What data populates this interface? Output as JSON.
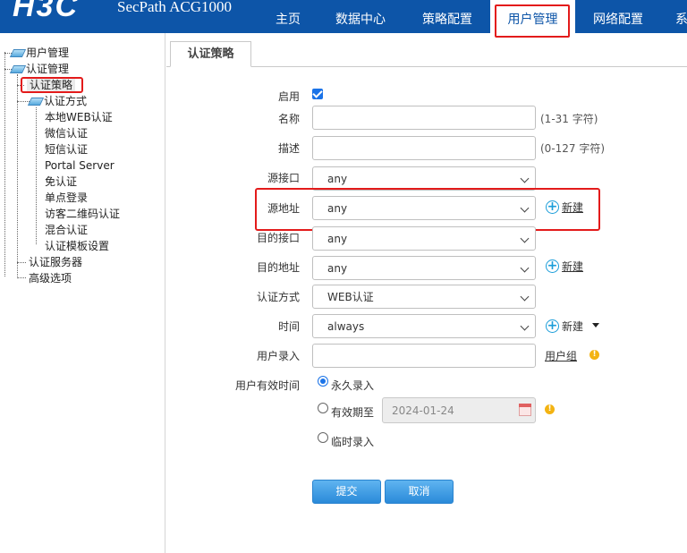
{
  "header": {
    "logo": "H3C",
    "product": "SecPath ACG1000",
    "nav": [
      "主页",
      "数据中心",
      "策略配置",
      "用户管理",
      "网络配置",
      "系"
    ],
    "active_nav": "用户管理",
    "colors": {
      "header_bg": "#0d55a8",
      "highlight": "#e31b1b"
    }
  },
  "sidebar": {
    "items": [
      "用户管理",
      "认证管理",
      "认证策略",
      "认证方式",
      "本地WEB认证",
      "微信认证",
      "短信认证",
      "Portal Server",
      "免认证",
      "单点登录",
      "访客二维码认证",
      "混合认证",
      "认证模板设置",
      "认证服务器",
      "高级选项"
    ],
    "selected": "认证策略"
  },
  "tab": {
    "label": "认证策略"
  },
  "form": {
    "enable_label": "启用",
    "enable_checked": true,
    "name_label": "名称",
    "name_hint": "(1-31 字符)",
    "desc_label": "描述",
    "desc_hint": "(0-127 字符)",
    "src_if_label": "源接口",
    "src_if_value": "any",
    "src_addr_label": "源地址",
    "src_addr_value": "any",
    "new_label": "新建",
    "dst_if_label": "目的接口",
    "dst_if_value": "any",
    "dst_addr_label": "目的地址",
    "dst_addr_value": "any",
    "auth_method_label": "认证方式",
    "auth_method_value": "WEB认证",
    "time_label": "时间",
    "time_value": "always",
    "user_entry_label": "用户录入",
    "user_group_label": "用户组",
    "validity_label": "用户有效时间",
    "opt_permanent": "永久录入",
    "opt_until": "有效期至",
    "opt_temporary": "临时录入",
    "selected_validity": "永久录入",
    "until_date": "2024-01-24",
    "submit": "提交",
    "cancel": "取消"
  }
}
